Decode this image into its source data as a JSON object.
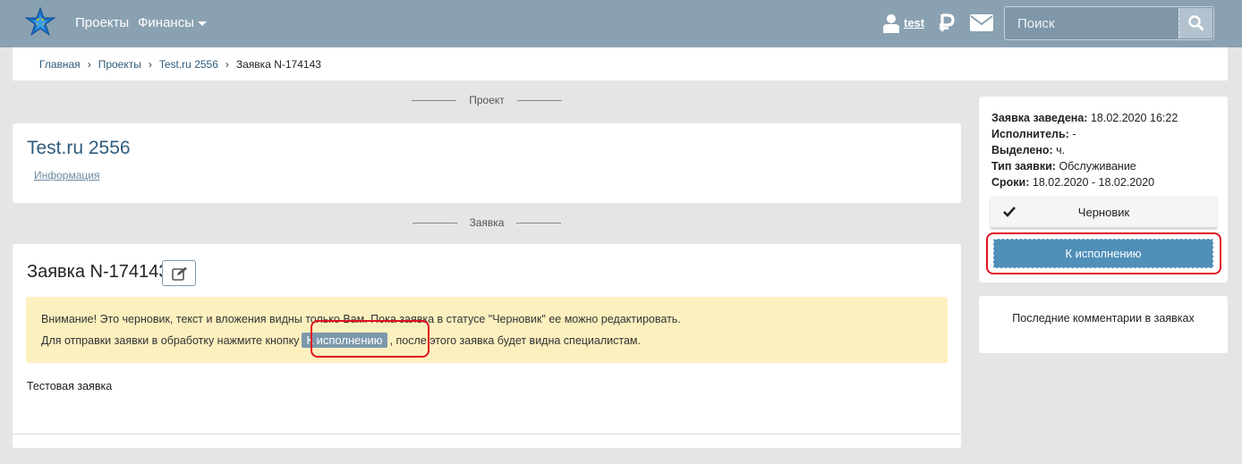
{
  "header": {
    "nav": {
      "projects": "Проекты",
      "finance": "Финансы"
    },
    "user": "test",
    "search": {
      "placeholder": "Поиск"
    }
  },
  "breadcrumb": [
    "Главная",
    "Проекты",
    "Test.ru 2556",
    "Заявка N-174143"
  ],
  "sections": {
    "project": "Проект",
    "ticket": "Заявка"
  },
  "project": {
    "title": "Test.ru 2556",
    "info_link": "Информация"
  },
  "ticket": {
    "title": "Заявка N-174143",
    "alert_line1": "Внимание! Это черновик, текст и вложения видны только Вам. Пока заявка в статусе \"Черновик\" ее можно редактировать.",
    "alert_line2_before": "Для отправки заявки в обработку нажмите кнопку",
    "alert_button": "К исполнению",
    "alert_line2_after": ", после этого заявка будет видна специалистам.",
    "body": "Тестовая заявка"
  },
  "sidebar": {
    "created_label": "Заявка заведена:",
    "created_value": "18.02.2020 16:22",
    "executor_label": "Исполнитель:",
    "executor_value": "-",
    "allocated_label": "Выделено:",
    "allocated_value": "ч.",
    "type_label": "Тип заявки:",
    "type_value": "Обслуживание",
    "deadline_label": "Сроки:",
    "deadline_value": "18.02.2020 - 18.02.2020",
    "status": "Черновик",
    "execute_button": "К исполнению",
    "comments_title": "Последние комментарии в заявках"
  },
  "colors": {
    "topbar": "#8aa1b1",
    "accent": "#4f8fb8",
    "alert": "#fcf0bf",
    "highlight": "#e0121f"
  }
}
